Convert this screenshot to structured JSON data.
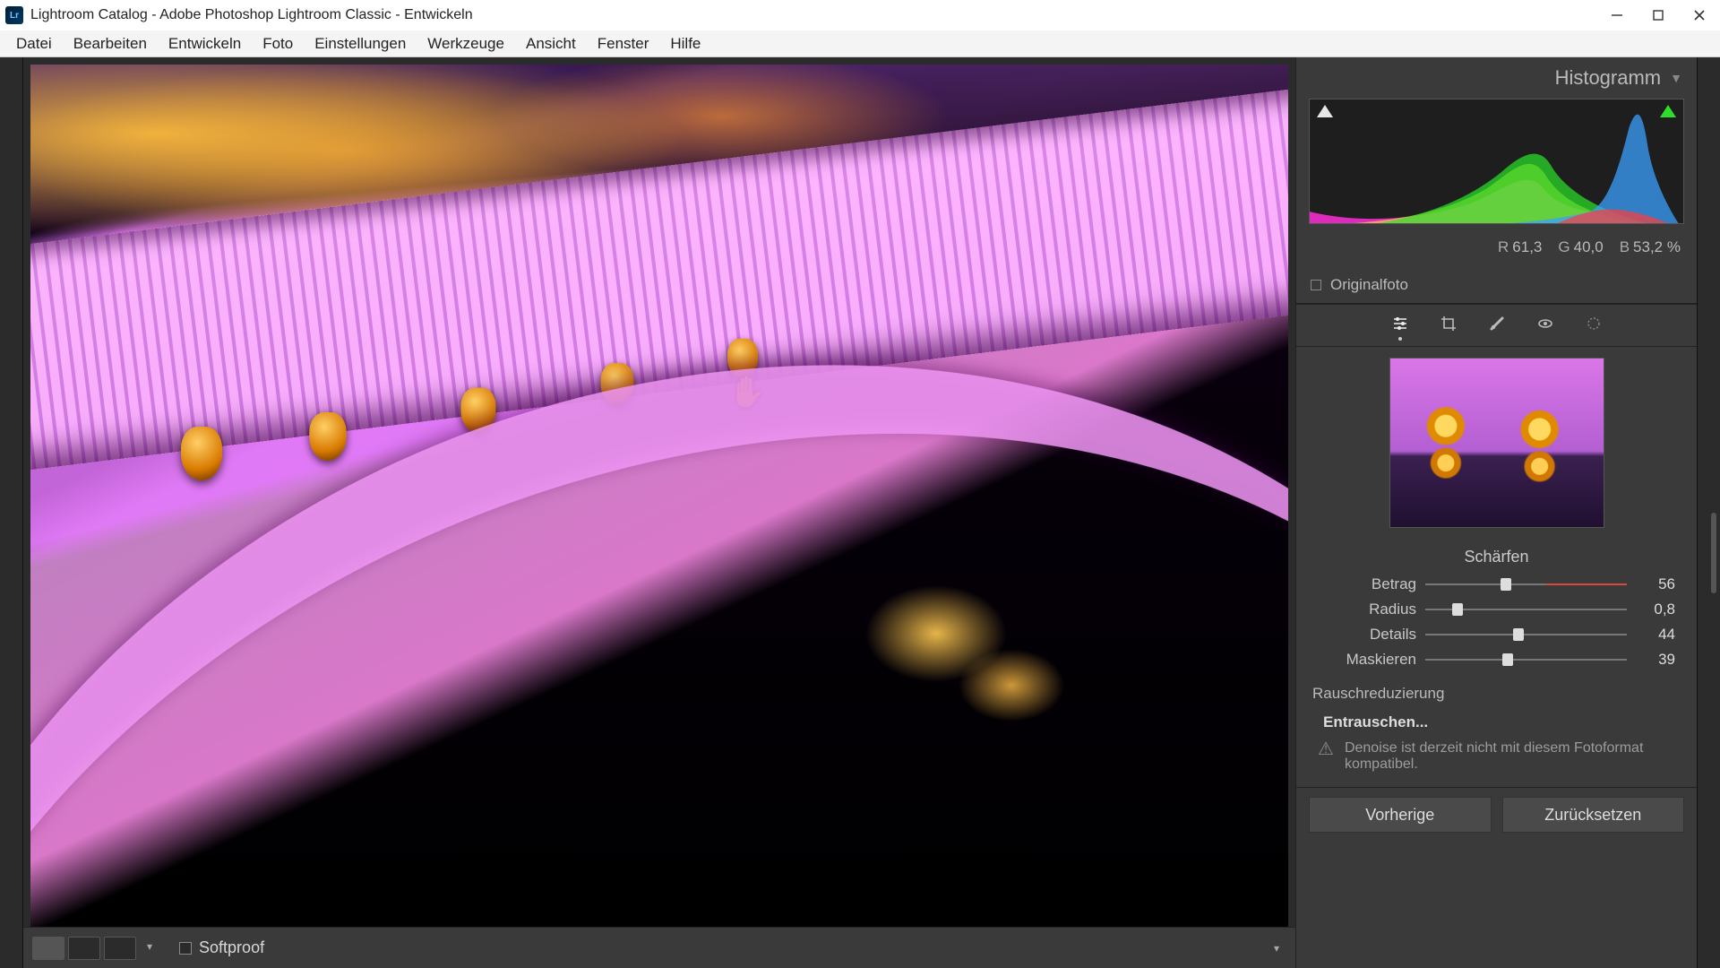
{
  "window": {
    "title": "Lightroom Catalog - Adobe Photoshop Lightroom Classic - Entwickeln",
    "app_abbrev": "Lr"
  },
  "menu": [
    "Datei",
    "Bearbeiten",
    "Entwickeln",
    "Foto",
    "Einstellungen",
    "Werkzeuge",
    "Ansicht",
    "Fenster",
    "Hilfe"
  ],
  "bottom": {
    "softproof_label": "Softproof"
  },
  "right": {
    "histogram_label": "Histogramm",
    "rgb": {
      "r_label": "R",
      "r": "61,3",
      "g_label": "G",
      "g": "40,0",
      "b_label": "B",
      "b": "53,2",
      "pct": "%"
    },
    "originalfoto": "Originalfoto",
    "sharpen": {
      "title": "Schärfen",
      "rows": [
        {
          "label": "Betrag",
          "value": "56",
          "pos": 40,
          "accent": true
        },
        {
          "label": "Radius",
          "value": "0,8",
          "pos": 16,
          "accent": false
        },
        {
          "label": "Details",
          "value": "44",
          "pos": 46,
          "accent": false
        },
        {
          "label": "Maskieren",
          "value": "39",
          "pos": 41,
          "accent": false
        }
      ]
    },
    "noise": {
      "title": "Rauschreduzierung",
      "denoise_btn": "Entrauschen...",
      "message": "Denoise ist derzeit nicht mit diesem Fotoformat kompatibel."
    },
    "buttons": {
      "prev": "Vorherige",
      "reset": "Zurücksetzen"
    }
  }
}
